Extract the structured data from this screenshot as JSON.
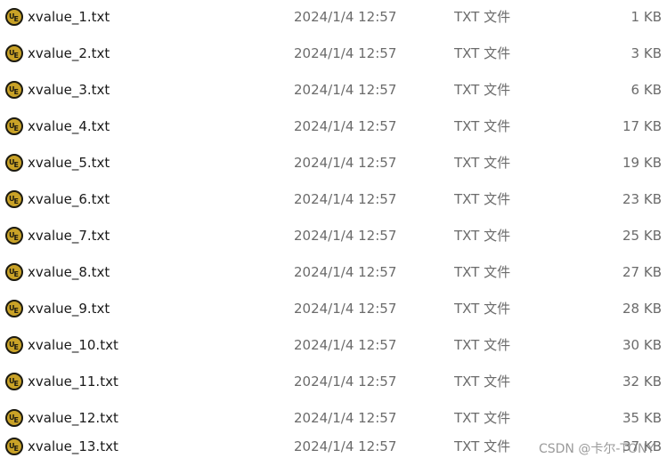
{
  "files": [
    {
      "name": "xvalue_1.txt",
      "modified": "2024/1/4 12:57",
      "type": "TXT 文件",
      "size": "1 KB"
    },
    {
      "name": "xvalue_2.txt",
      "modified": "2024/1/4 12:57",
      "type": "TXT 文件",
      "size": "3 KB"
    },
    {
      "name": "xvalue_3.txt",
      "modified": "2024/1/4 12:57",
      "type": "TXT 文件",
      "size": "6 KB"
    },
    {
      "name": "xvalue_4.txt",
      "modified": "2024/1/4 12:57",
      "type": "TXT 文件",
      "size": "17 KB"
    },
    {
      "name": "xvalue_5.txt",
      "modified": "2024/1/4 12:57",
      "type": "TXT 文件",
      "size": "19 KB"
    },
    {
      "name": "xvalue_6.txt",
      "modified": "2024/1/4 12:57",
      "type": "TXT 文件",
      "size": "23 KB"
    },
    {
      "name": "xvalue_7.txt",
      "modified": "2024/1/4 12:57",
      "type": "TXT 文件",
      "size": "25 KB"
    },
    {
      "name": "xvalue_8.txt",
      "modified": "2024/1/4 12:57",
      "type": "TXT 文件",
      "size": "27 KB"
    },
    {
      "name": "xvalue_9.txt",
      "modified": "2024/1/4 12:57",
      "type": "TXT 文件",
      "size": "28 KB"
    },
    {
      "name": "xvalue_10.txt",
      "modified": "2024/1/4 12:57",
      "type": "TXT 文件",
      "size": "30 KB"
    },
    {
      "name": "xvalue_11.txt",
      "modified": "2024/1/4 12:57",
      "type": "TXT 文件",
      "size": "32 KB"
    },
    {
      "name": "xvalue_12.txt",
      "modified": "2024/1/4 12:57",
      "type": "TXT 文件",
      "size": "35 KB"
    },
    {
      "name": "xvalue_13.txt",
      "modified": "2024/1/4 12:57",
      "type": "TXT 文件",
      "size": "37 KB"
    }
  ],
  "file_icon": "ultraedit-file-icon",
  "watermark": "CSDN @卡尔-TONY",
  "colors": {
    "icon_ring": "#1c1a10",
    "icon_fill": "#c9a227",
    "name_text": "#1a1a1a",
    "meta_text": "#6b6b6b"
  }
}
